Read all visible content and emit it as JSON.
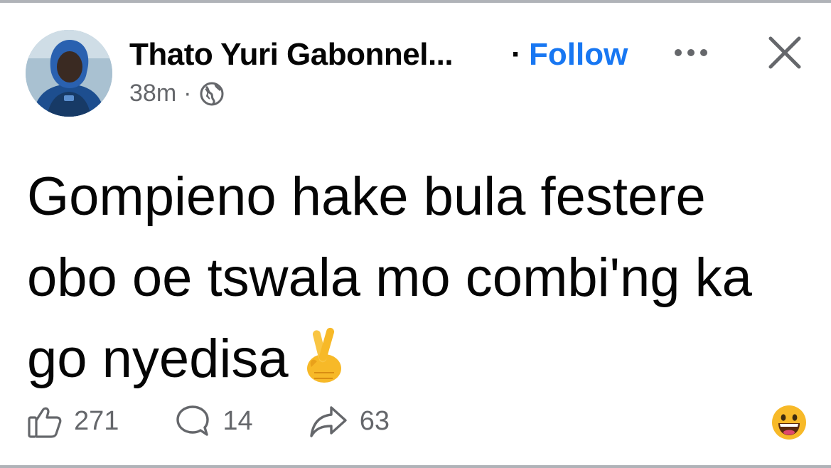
{
  "post": {
    "author_name": "Thato Yuri Gabonnel...",
    "separator": "·",
    "follow_label": "Follow",
    "time": "38m",
    "meta_separator": "·",
    "text": "Gompieno hake bula festere obo oe tswala mo combi'ng ka go nyedisa",
    "text_emoji": "crossed-fingers-icon"
  },
  "actions": {
    "likes": "271",
    "comments": "14",
    "shares": "63",
    "reaction_icon": "grinning-face-icon"
  },
  "colors": {
    "accent": "#1877f2",
    "muted": "#65676b",
    "text": "#050505",
    "border": "#b0b3b8"
  }
}
